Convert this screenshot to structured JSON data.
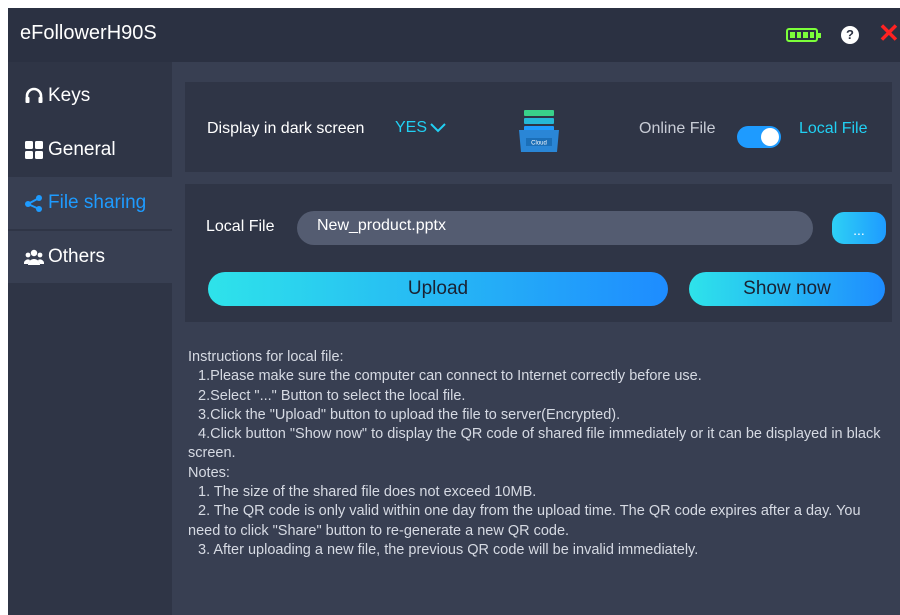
{
  "window": {
    "title": "eFollowerH90S"
  },
  "titlebar": {
    "help_glyph": "?",
    "close_glyph": "✕",
    "battery_color": "#7cff3a",
    "close_color": "#ff2222"
  },
  "sidebar": {
    "items": [
      {
        "label": "Keys",
        "icon": "headphones-icon"
      },
      {
        "label": "General",
        "icon": "grid-icon"
      },
      {
        "label": "File sharing",
        "icon": "share-icon"
      },
      {
        "label": "Others",
        "icon": "group-icon"
      }
    ],
    "active_index": 2,
    "active_color": "#1e9bff"
  },
  "display": {
    "label": "Display in dark screen",
    "value": "YES",
    "cloud_icon_text": "Cloud",
    "toggle_left": "Online File",
    "toggle_right": "Local File",
    "toggle_state": "Local File"
  },
  "local": {
    "label": "Local File",
    "value": "New_product.pptx",
    "browse_label": "...",
    "upload_label": "Upload",
    "show_label": "Show now"
  },
  "instructions": {
    "lines": [
      "Instructions for local file:",
      "1.Please make sure the computer can connect to Internet correctly before use.",
      "2.Select \"...\" Button to select the local file.",
      "3.Click the \"Upload\" button to upload the file to server(Encrypted).",
      "4.Click button \"Show now\" to display the QR code of shared file immediately or it can be displayed in black screen.",
      "Notes:",
      "1. The size of the shared file does not exceed 10MB.",
      "2. The QR code is only valid within one day from the upload time. The QR code expires after a day. You need to click \"Share\" button to re-generate a new QR code.",
      "3. After uploading a new file, the previous QR code will be invalid immediately."
    ]
  },
  "colors": {
    "accent": "#21d0f3",
    "button_gradient_start": "#2ee3ea",
    "button_gradient_end": "#1e8cff"
  }
}
